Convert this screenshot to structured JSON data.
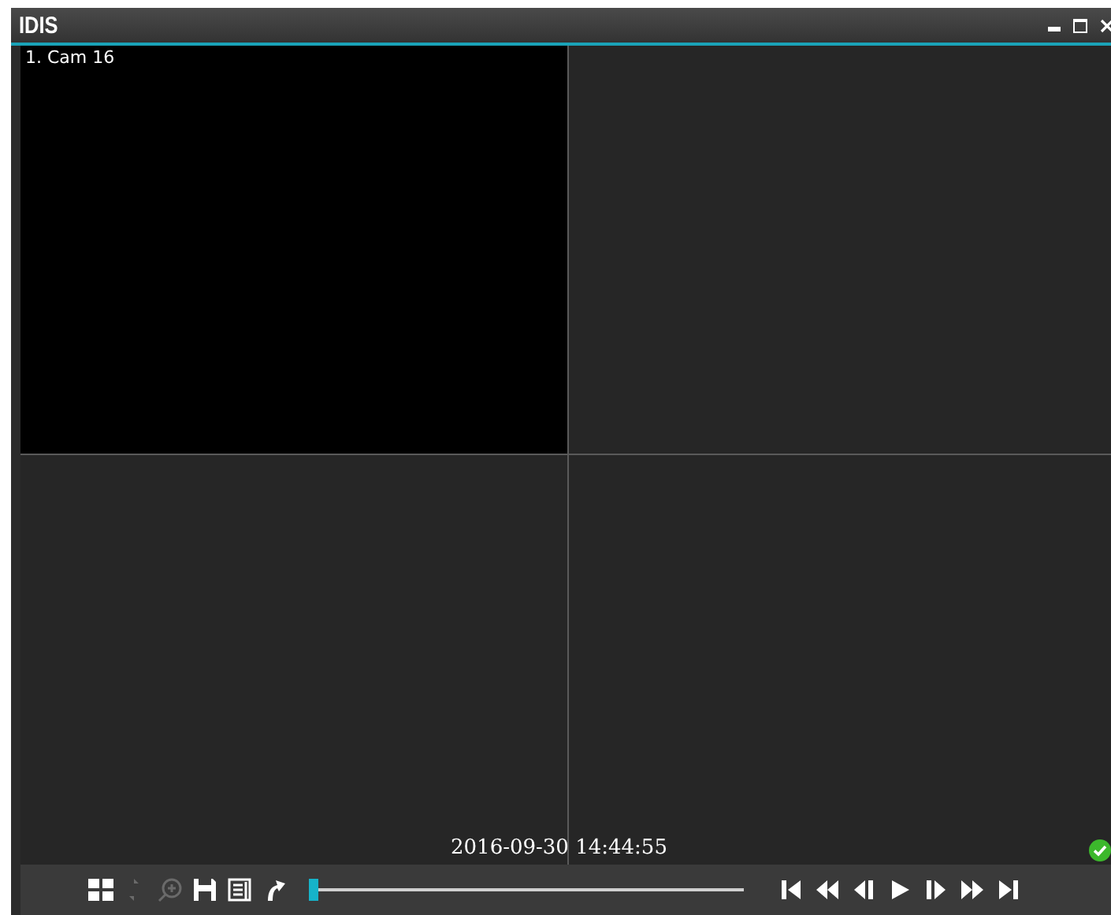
{
  "window": {
    "title": "IDIS"
  },
  "cells": [
    {
      "label": "1. Cam 16",
      "kind": "video"
    },
    {
      "kind": "empty"
    },
    {
      "kind": "empty"
    },
    {
      "kind": "empty"
    }
  ],
  "timestamp": "2016-09-30 14:44:55",
  "toolbar": [
    {
      "kind": "layout",
      "disabled": false
    },
    {
      "kind": "arrows",
      "disabled": true
    },
    {
      "kind": "zoom",
      "disabled": true
    },
    {
      "kind": "save",
      "disabled": false
    },
    {
      "kind": "panel",
      "disabled": false
    },
    {
      "kind": "export",
      "disabled": false
    }
  ],
  "timeline": {
    "level": 0
  },
  "playback": [
    {
      "kind": "first"
    },
    {
      "kind": "rewind"
    },
    {
      "kind": "step-back"
    },
    {
      "kind": "play"
    },
    {
      "kind": "step-forward"
    },
    {
      "kind": "fast-forward"
    },
    {
      "kind": "last"
    }
  ]
}
